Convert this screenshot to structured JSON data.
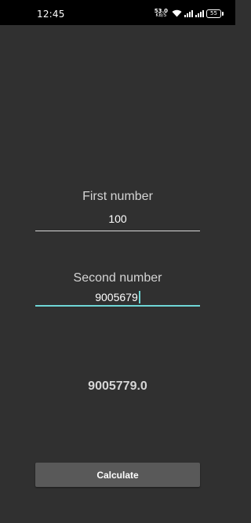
{
  "status_bar": {
    "time": "12:45",
    "net_speed_value": "53.0",
    "net_speed_unit": "KB/S",
    "battery_level": "55",
    "icons": [
      "wifi-icon",
      "signal-icon",
      "signal-icon",
      "battery-icon"
    ]
  },
  "first_field": {
    "label": "First number",
    "value": "100"
  },
  "second_field": {
    "label": "Second number",
    "value": "9005679"
  },
  "result": {
    "value": "9005779.0"
  },
  "calculate_button": {
    "label": "Calculate"
  },
  "colors": {
    "background": "#303030",
    "status_bar": "#000000",
    "accent": "#6fd6d6",
    "button": "#595959"
  }
}
